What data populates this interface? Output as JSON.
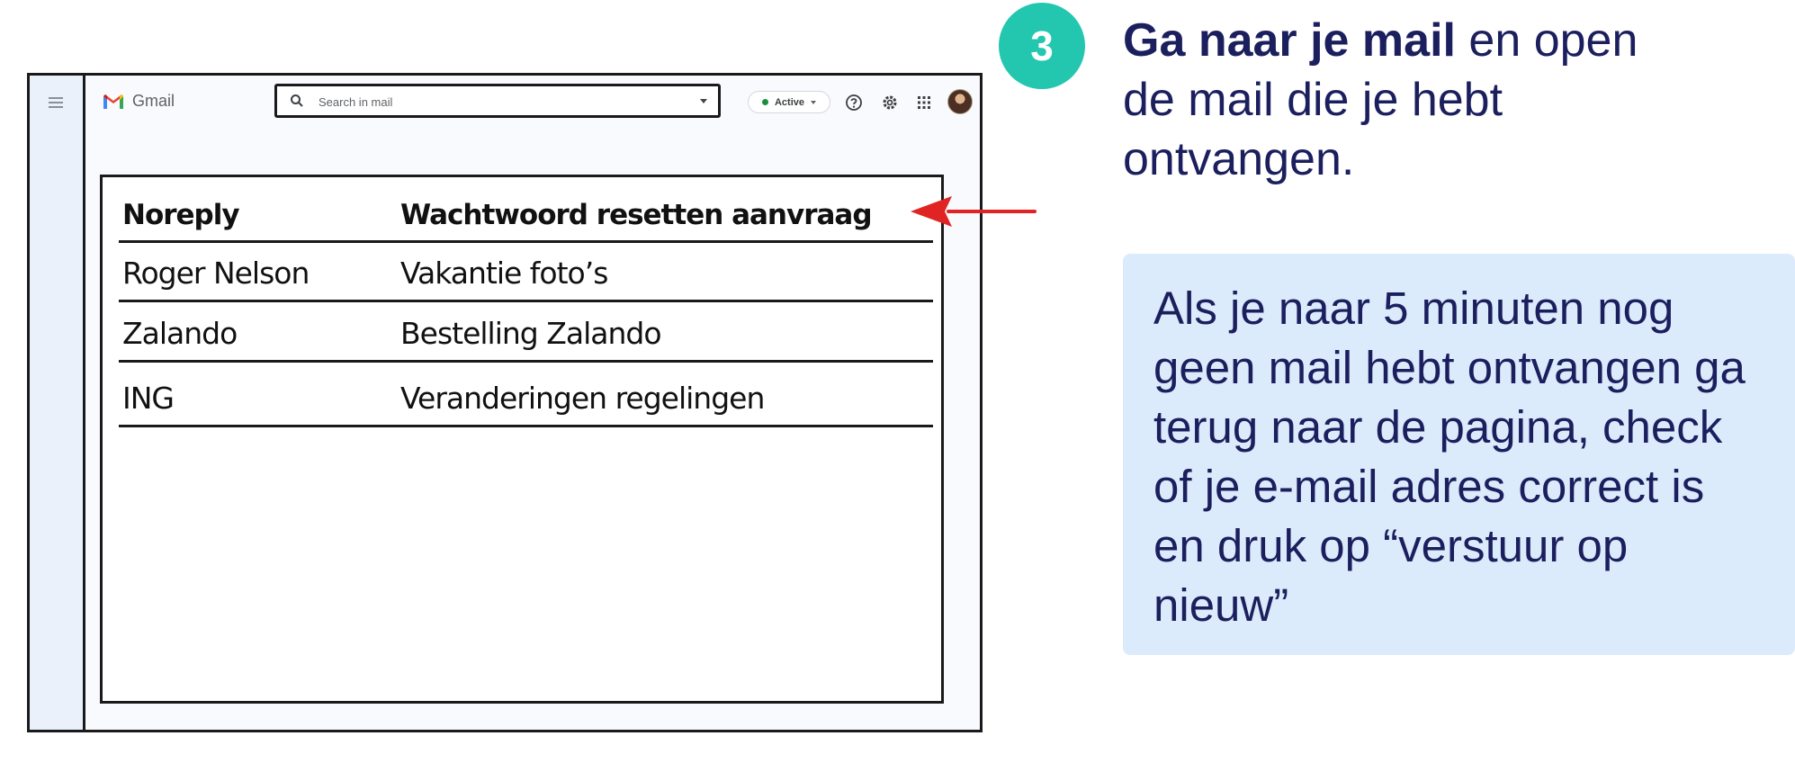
{
  "gmail": {
    "app_name": "Gmail",
    "search": {
      "placeholder": "Search in mail"
    },
    "status": {
      "label": "Active",
      "color": "#1e8e3e"
    },
    "icons": [
      "menu-icon",
      "gmail-logo-icon",
      "search-icon",
      "help-icon",
      "settings-icon",
      "apps-grid-icon",
      "avatar"
    ],
    "emails": [
      {
        "sender": "Noreply",
        "subject": "Wachtwoord resetten aanvraag",
        "highlighted": true
      },
      {
        "sender": "Roger Nelson",
        "subject": "Vakantie foto’s",
        "highlighted": false
      },
      {
        "sender": "Zalando",
        "subject": "Bestelling Zalando",
        "highlighted": false
      },
      {
        "sender": "ING",
        "subject": "Veranderingen regelingen",
        "highlighted": false
      }
    ]
  },
  "step": {
    "number": "3",
    "title_bold": "Ga naar je mail",
    "title_rest": " en open de mail die je hebt ontvangen."
  },
  "tip": {
    "text": "Als je naar 5 minuten nog geen mail hebt ontvangen ga terug naar de pagina, check of je e-mail adres correct is en druk op “verstuur op nieuw”"
  },
  "colors": {
    "accent_teal": "#23c7b0",
    "text_navy": "#1b1f5e",
    "tip_background": "#dcebfb",
    "arrow_red": "#e02424"
  }
}
